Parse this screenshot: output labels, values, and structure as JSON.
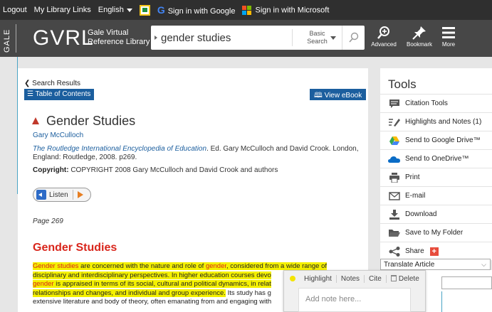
{
  "topbar": {
    "logout": "Logout",
    "library_links": "My Library Links",
    "language": "English",
    "google_signin": "Sign in with Google",
    "microsoft_signin": "Sign in with Microsoft"
  },
  "header": {
    "brand_vertical": "GALE",
    "brand": "GVRL",
    "brand_line1": "Gale Virtual",
    "brand_line2": "Reference Library",
    "search_query": "gender studies",
    "search_mode_line1": "Basic",
    "search_mode_line2": "Search",
    "advanced": "Advanced",
    "bookmark": "Bookmark",
    "more": "More"
  },
  "article": {
    "back_link": "Search Results",
    "toc_button": "Table of Contents",
    "ebook_button": "View eBook",
    "title": "Gender Studies",
    "author": "Gary McCulloch",
    "source_title": "The Routledge International Encyclopedia of Education",
    "source_rest": ". Ed. Gary McCulloch and David Crook. London, England: Routledge, 2008. p269.",
    "copyright_label": "Copyright:",
    "copyright_text": " COPYRIGHT 2008 Gary McCulloch and David Crook and authors",
    "listen": "Listen",
    "page_label": "Page 269",
    "section_heading": "Gender Studies",
    "body": {
      "l1_w1": "Gender",
      "l1_w2": "studies",
      "l1_a": " are concerned with the nature and role of ",
      "l1_w3": "gender",
      "l1_b": ", considered from a wide range of",
      "l2": "disciplinary and interdisciplinary perspectives. In higher education courses devo",
      "l3_w": "gender",
      "l3_rest": " is appraised in terms of its social, cultural and political dynamics, in relat",
      "l4_hl": "relationships and changes, and individual and group experience.",
      "l4_rest": " Its study has g",
      "l5": "extensive literature and body of theory, often emanating from and engaging with"
    }
  },
  "popover": {
    "highlight": "Highlight",
    "notes": "Notes",
    "cite": "Cite",
    "delete": "Delete",
    "note_placeholder": "Add note here..."
  },
  "tools": {
    "title": "Tools",
    "items": [
      {
        "label": "Citation Tools"
      },
      {
        "label": "Highlights and Notes (1)"
      },
      {
        "label": "Send to Google Drive™"
      },
      {
        "label": "Send to OneDrive™"
      },
      {
        "label": "Print"
      },
      {
        "label": "E-mail"
      },
      {
        "label": "Download"
      },
      {
        "label": "Save to My Folder"
      },
      {
        "label": "Share"
      }
    ],
    "translate": "Translate Article"
  },
  "colors": {
    "topbar": "#2f2f2f",
    "header": "#474747",
    "accent_blue": "#1b5e9e",
    "heading_red": "#d9261c",
    "highlight_yellow": "#f4f000"
  }
}
